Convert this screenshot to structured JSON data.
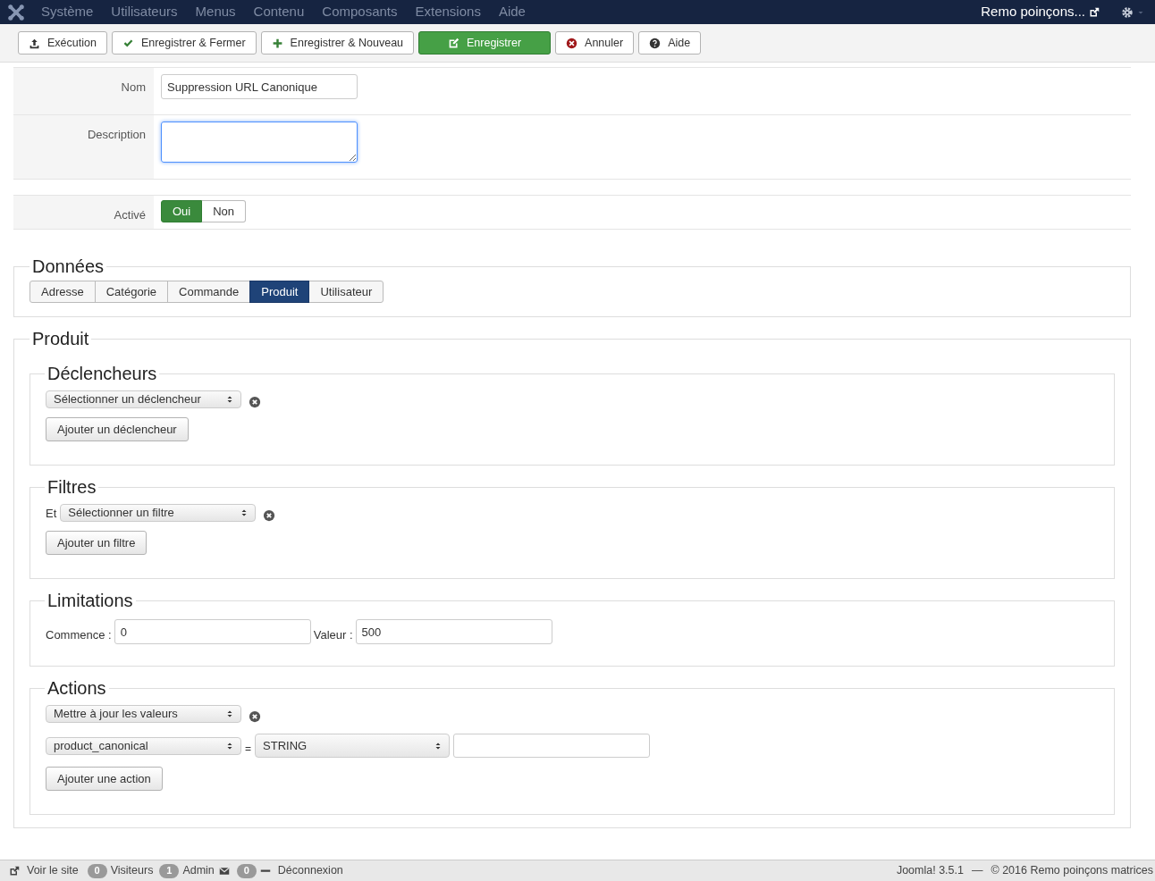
{
  "menu": {
    "items": [
      "Système",
      "Utilisateurs",
      "Menus",
      "Contenu",
      "Composants",
      "Extensions",
      "Aide"
    ],
    "site_link": "Remo poinçons..."
  },
  "toolbar": [
    {
      "label": "Exécution",
      "kind": "upload"
    },
    {
      "label": "Enregistrer & Fermer",
      "kind": "check"
    },
    {
      "label": "Enregistrer & Nouveau",
      "kind": "plus"
    },
    {
      "label": "Enregistrer",
      "kind": "primary"
    },
    {
      "label": "Annuler",
      "kind": "cancel"
    },
    {
      "label": "Aide",
      "kind": "help"
    }
  ],
  "form": {
    "name": {
      "label": "Nom",
      "value": "Suppression URL Canonique"
    },
    "description": {
      "label": "Description"
    },
    "active": {
      "label": "Activé",
      "options": [
        {
          "label": "Oui",
          "selected": true
        },
        {
          "label": "Non",
          "selected": false
        }
      ]
    }
  },
  "data": {
    "legend": "Données",
    "tabs": [
      {
        "label": "Adresse",
        "selected": false
      },
      {
        "label": "Catégorie",
        "selected": false
      },
      {
        "label": "Commande",
        "selected": false
      },
      {
        "label": "Produit",
        "selected": true
      },
      {
        "label": "Utilisateur",
        "selected": false
      }
    ]
  },
  "product": {
    "legend": "Produit",
    "triggers": {
      "legend": "Déclencheurs",
      "select": "Sélectionner un déclencheur",
      "add_button": "Ajouter un déclencheur"
    },
    "filters": {
      "legend": "Filtres",
      "prefix": "Et",
      "select": "Sélectionner un filtre",
      "add_button": "Ajouter un filtre"
    },
    "limitations": {
      "legend": "Limitations",
      "fields": [
        {
          "label": "Commence :",
          "value": "0"
        },
        {
          "label": "Valeur :",
          "value": "500"
        }
      ]
    },
    "actions": {
      "legend": "Actions",
      "select": "Mettre à jour les valeurs",
      "field_select": "product_canonical",
      "equals": "=",
      "type_select": "STRING",
      "add_button": "Ajouter une action"
    }
  },
  "status_bar": {
    "view_site": "Voir le site",
    "visitors": {
      "count": "0",
      "label": "Visiteurs"
    },
    "admins": {
      "count": "1",
      "label": "Admin"
    },
    "messages": {
      "count": "0"
    },
    "logout": "Déconnexion",
    "version": "Joomla! 3.5.1",
    "separator": "—",
    "copyright": "© 2016 Remo poinçons matrices"
  }
}
